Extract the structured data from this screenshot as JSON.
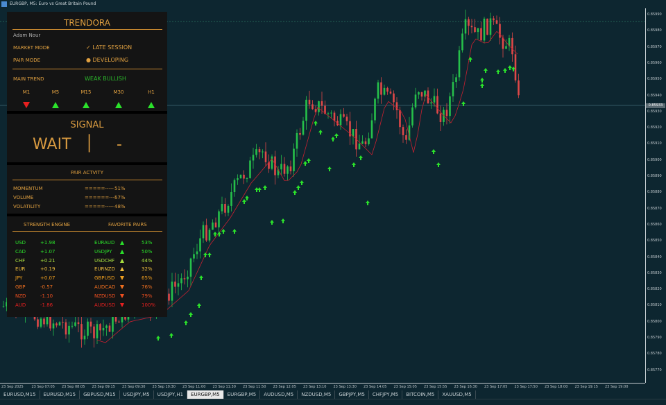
{
  "window": {
    "title": "EURGBP, M5: Euro vs Great Britain Pound"
  },
  "panel": {
    "title": "TRENDORA",
    "user": "Adam Nour",
    "market_mode_label": "MARKET MODE",
    "market_mode_value": "✓  LATE SESSION",
    "pair_mode_label": "PAIR MODE",
    "pair_mode_value": "●  DEVELOPING",
    "main_trend_label": "MAIN TREND",
    "main_trend_value": "WEAK BULLISH",
    "timeframes": [
      {
        "label": "M1",
        "dir": "down"
      },
      {
        "label": "M5",
        "dir": "up"
      },
      {
        "label": "M15",
        "dir": "up"
      },
      {
        "label": "M30",
        "dir": "up"
      },
      {
        "label": "H1",
        "dir": "up"
      }
    ],
    "signal_title": "SIGNAL",
    "signal_value": "WAIT",
    "signal_sep": "│",
    "signal_side": "-",
    "activity_title": "PAIR ACTVITY",
    "activity": [
      {
        "label": "MOMENTUM",
        "bar": "=====-----",
        "pct": "51%"
      },
      {
        "label": "VOLUME",
        "bar": "======----",
        "pct": "57%"
      },
      {
        "label": "VOLATILITY",
        "bar": "=====-----",
        "pct": "48%"
      }
    ],
    "strength_title": "STRENGTH ENGINE",
    "favorites_title": "FAVORITE PAIRS",
    "strength": [
      {
        "cur": "USD",
        "val": "+1.98",
        "color": "#2be22b"
      },
      {
        "cur": "CAD",
        "val": "+1.07",
        "color": "#2be22b"
      },
      {
        "cur": "CHF",
        "val": "+0.21",
        "color": "#a8e040"
      },
      {
        "cur": "EUR",
        "val": "+0.19",
        "color": "#f0c040"
      },
      {
        "cur": "JPY",
        "val": "+0.07",
        "color": "#f0a020"
      },
      {
        "cur": "GBP",
        "val": "-0.57",
        "color": "#f07020"
      },
      {
        "cur": "NZD",
        "val": "-1.10",
        "color": "#f05020"
      },
      {
        "cur": "AUD",
        "val": "-1.86",
        "color": "#e82020"
      }
    ],
    "favorites": [
      {
        "pair": "EURAUD",
        "dir": "up",
        "pct": "53%",
        "color": "#2be22b"
      },
      {
        "pair": "USDJPY",
        "dir": "up",
        "pct": "50%",
        "color": "#2be22b"
      },
      {
        "pair": "USDCHF",
        "dir": "up",
        "pct": "44%",
        "color": "#a8e040"
      },
      {
        "pair": "EURNZD",
        "dir": "up",
        "pct": "32%",
        "color": "#f0c040"
      },
      {
        "pair": "GBPUSD",
        "dir": "down",
        "pct": "65%",
        "color": "#f0a020"
      },
      {
        "pair": "AUDCAD",
        "dir": "down",
        "pct": "76%",
        "color": "#f07020"
      },
      {
        "pair": "NZDUSD",
        "dir": "down",
        "pct": "79%",
        "color": "#f05020"
      },
      {
        "pair": "AUDUSD",
        "dir": "down",
        "pct": "100%",
        "color": "#e82020"
      }
    ]
  },
  "price_axis": {
    "labels": [
      "0.85990",
      "0.85980",
      "0.85970",
      "0.85960",
      "0.85950",
      "0.85940",
      "0.85930",
      "0.85920",
      "0.85910",
      "0.85900",
      "0.85890",
      "0.85880",
      "0.85870",
      "0.85860",
      "0.85850",
      "0.85840",
      "0.85830",
      "0.85820",
      "0.85810",
      "0.85800",
      "0.85790",
      "0.85780",
      "0.85770"
    ],
    "current": "0.85933"
  },
  "time_axis": [
    "23 Sep 2025",
    "23 Sep 07:05",
    "23 Sep 08:05",
    "23 Sep 09:15",
    "23 Sep 09:30",
    "23 Sep 10:30",
    "23 Sep 11:00",
    "23 Sep 11:30",
    "23 Sep 11:50",
    "23 Sep 12:05",
    "23 Sep 13:10",
    "23 Sep 13:30",
    "23 Sep 14:05",
    "23 Sep 15:05",
    "23 Sep 15:55",
    "23 Sep 16:30",
    "23 Sep 17:05",
    "23 Sep 17:50",
    "23 Sep 18:00",
    "23 Sep 19:15",
    "23 Sep 19:00"
  ],
  "tabs": [
    "EURUSD,M15",
    "EURUSD,M15",
    "GBPUSD,M15",
    "USDJPY,M5",
    "USDJPY,H1",
    "EURGBP,M5",
    "EURGBP,M5",
    "AUDUSD,M5",
    "NZDUSD,M5",
    "GBPJPY,M5",
    "CHFJPY,M5",
    "BITCOIN,M5",
    "XAUUSD,M5"
  ],
  "active_tab": 5,
  "colors": {
    "bull": "#26c04a",
    "bear": "#e04848",
    "bg": "#0d2630",
    "accent": "#e0a040"
  }
}
